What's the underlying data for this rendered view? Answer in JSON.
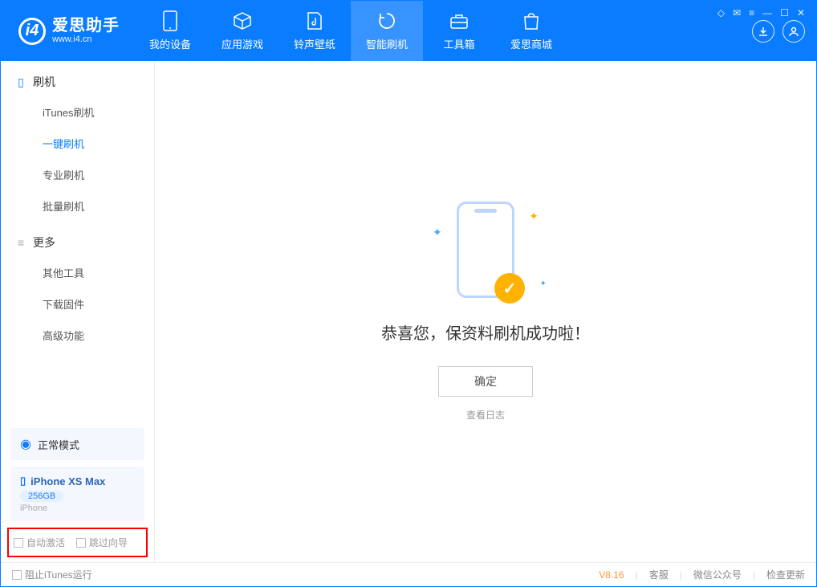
{
  "app": {
    "name_cn": "爱思助手",
    "name_en": "www.i4.cn"
  },
  "tabs": [
    {
      "label": "我的设备"
    },
    {
      "label": "应用游戏"
    },
    {
      "label": "铃声壁纸"
    },
    {
      "label": "智能刷机"
    },
    {
      "label": "工具箱"
    },
    {
      "label": "爱思商城"
    }
  ],
  "sidebar": {
    "group1_title": "刷机",
    "group1_items": [
      "iTunes刷机",
      "一键刷机",
      "专业刷机",
      "批量刷机"
    ],
    "group2_title": "更多",
    "group2_items": [
      "其他工具",
      "下载固件",
      "高级功能"
    ]
  },
  "mode": {
    "label": "正常模式"
  },
  "device": {
    "name": "iPhone XS Max",
    "capacity": "256GB",
    "platform": "iPhone"
  },
  "bottom_opts": {
    "auto_activate": "自动激活",
    "skip_guide": "跳过向导"
  },
  "main": {
    "success_text": "恭喜您，保资料刷机成功啦！",
    "ok_btn": "确定",
    "log_link": "查看日志"
  },
  "footer": {
    "block_itunes": "阻止iTunes运行",
    "version": "V8.16",
    "links": [
      "客服",
      "微信公众号",
      "检查更新"
    ]
  }
}
